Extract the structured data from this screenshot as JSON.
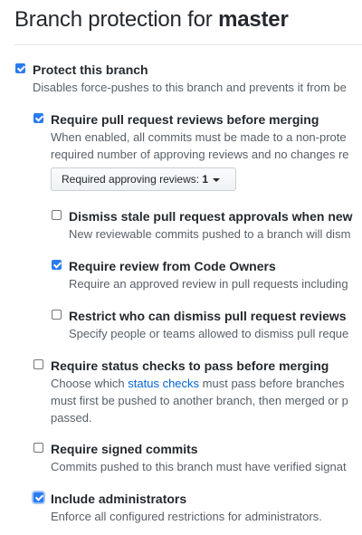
{
  "page": {
    "title_prefix": "Branch protection for ",
    "branch": "master"
  },
  "options": [
    {
      "label": "Protect this branch",
      "checked": true,
      "notes": [
        "Disables force-pushes to this branch and prevents it from be"
      ]
    },
    {
      "label": "Require pull request reviews before merging",
      "checked": true,
      "notes": [
        "When enabled, all commits must be made to a non-prote",
        "required number of approving reviews and no changes re"
      ]
    },
    {
      "label": "Dismiss stale pull request approvals when new",
      "checked": false,
      "notes": [
        "New reviewable commits pushed to a branch will dism"
      ]
    },
    {
      "label": "Require review from Code Owners",
      "checked": true,
      "notes": [
        "Require an approved review in pull requests including"
      ]
    },
    {
      "label": "Restrict who can dismiss pull request reviews",
      "checked": false,
      "notes": [
        "Specify people or teams allowed to dismiss pull reque"
      ]
    },
    {
      "label": "Require status checks to pass before merging",
      "checked": false,
      "notes_prefix": "Choose which ",
      "link": "status checks",
      "notes_suffix": " must pass before branches",
      "notes": [
        "must first be pushed to another branch, then merged or p",
        "passed."
      ]
    },
    {
      "label": "Require signed commits",
      "checked": false,
      "notes": [
        "Commits pushed to this branch must have verified signat"
      ]
    },
    {
      "label": "Include administrators",
      "checked": true,
      "notes": [
        "Enforce all configured restrictions for administrators."
      ]
    }
  ],
  "reviews_dropdown": {
    "label": "Required approving reviews: ",
    "value": "1"
  },
  "colors": {
    "checkbox_checked": "#2a7bf0",
    "link": "#0366d6",
    "note_text": "#586069"
  }
}
